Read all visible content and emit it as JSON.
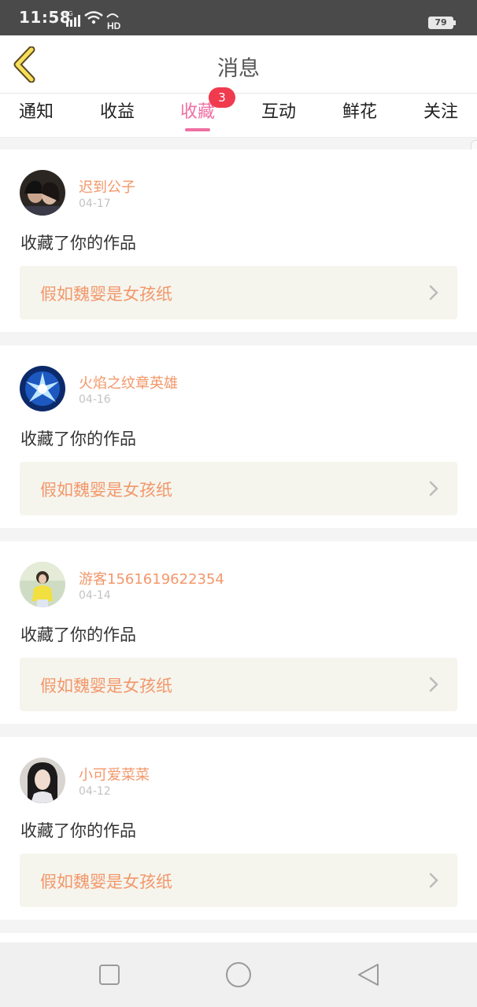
{
  "status_bar": {
    "time": "11:58",
    "network": "4G",
    "hd": "HD",
    "battery": "79"
  },
  "header": {
    "title": "消息",
    "back_icon": "chevron-left-icon"
  },
  "tabs": [
    {
      "label": "通知",
      "active": false
    },
    {
      "label": "收益",
      "active": false
    },
    {
      "label": "收藏",
      "active": true,
      "badge": "3"
    },
    {
      "label": "互动",
      "active": false
    },
    {
      "label": "鲜花",
      "active": false
    },
    {
      "label": "关注",
      "active": false
    }
  ],
  "colors": {
    "accent_pink": "#ef6fa1",
    "name_orange": "#f3976a",
    "badge_red": "#f03a4e"
  },
  "messages": [
    {
      "user": "迟到公子",
      "date": "04-17",
      "action": "收藏了你的作品",
      "work": "假如魏婴是女孩纸"
    },
    {
      "user": "火焰之纹章英雄",
      "date": "04-16",
      "action": "收藏了你的作品",
      "work": "假如魏婴是女孩纸"
    },
    {
      "user": "游客1561619622354",
      "date": "04-14",
      "action": "收藏了你的作品",
      "work": "假如魏婴是女孩纸"
    },
    {
      "user": "小可爱菜菜",
      "date": "04-12",
      "action": "收藏了你的作品",
      "work": "假如魏婴是女孩纸"
    }
  ],
  "nav_bar": {
    "icons": [
      "recents-square-icon",
      "home-circle-icon",
      "back-triangle-icon"
    ]
  }
}
